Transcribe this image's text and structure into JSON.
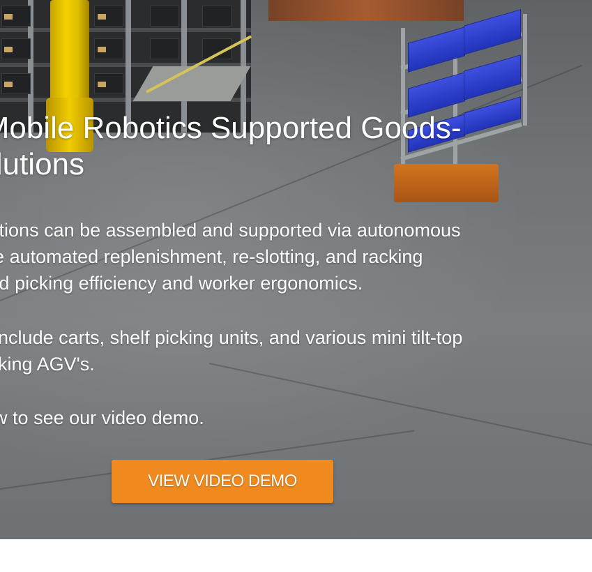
{
  "hero": {
    "headline_lines": [
      "d Mobile Robotics Supported Goods-",
      "Solutions"
    ],
    "paragraph1_lines": [
      "n stations can be assembled and supported via autonomous",
      "nable automated replenishment, re-slotting, and racking",
      "anced picking efficiency and worker ergonomics."
    ],
    "paragraph2_lines": [
      "sed include carts, shelf picking units, and various mini tilt-top",
      "o picking AGV's."
    ],
    "paragraph3_lines": [
      "below to see our video demo."
    ],
    "cta_label": "VIEW VIDEO DEMO"
  },
  "colors": {
    "cta_background": "#f08a1e",
    "text": "#ffffff",
    "pole_yellow": "#f2d000",
    "cart_blue": "#2f43d0",
    "agv_orange": "#d2731e"
  },
  "icons": {
    "background_image": "warehouse-robot-photo"
  }
}
